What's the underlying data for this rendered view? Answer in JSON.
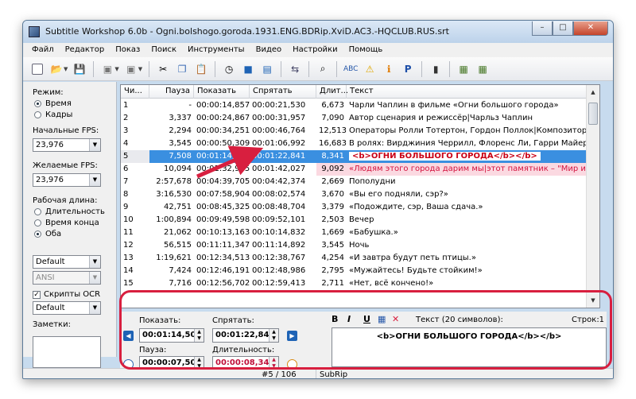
{
  "window": {
    "title": "Subtitle Workshop 6.0b - Ogni.bolshogo.goroda.1931.ENG.BDRip.XviD.AC3.-HQCLUB.RUS.srt",
    "buttons": {
      "minimize": "–",
      "maximize": "□",
      "close": "✕"
    }
  },
  "menu": [
    "Файл",
    "Редактор",
    "Показ",
    "Поиск",
    "Инструменты",
    "Видео",
    "Настройки",
    "Помощь"
  ],
  "left": {
    "mode_label": "Режим:",
    "mode_time": "Время",
    "mode_frames": "Кадры",
    "start_fps_label": "Начальные FPS:",
    "start_fps": "23,976",
    "desired_fps_label": "Желаемые FPS:",
    "desired_fps": "23,976",
    "work_length_label": "Рабочая длина:",
    "wl_duration": "Длительность",
    "wl_end_time": "Время конца",
    "wl_both": "Оба",
    "style_combo": "Default",
    "encoding_combo": "ANSI",
    "ocr_scripts": "Скрипты OCR",
    "ocr_combo": "Default",
    "notes_label": "Заметки:"
  },
  "grid": {
    "headers": {
      "num": "Чи...",
      "pause": "Пауза",
      "show": "Показать",
      "hide": "Спрятать",
      "dur": "Длит...",
      "text": "Текст"
    },
    "rows": [
      {
        "num": "1",
        "pause": "-",
        "show": "00:00:14,857",
        "hide": "00:00:21,530",
        "dur": "6,673",
        "text": "Чарли Чаплин в фильме «Огни большого города»"
      },
      {
        "num": "2",
        "pause": "3,337",
        "show": "00:00:24,867",
        "hide": "00:00:31,957",
        "dur": "7,090",
        "text": "Автор сценария и режиссёр|Чарльз Чаплин"
      },
      {
        "num": "3",
        "pause": "2,294",
        "show": "00:00:34,251",
        "hide": "00:00:46,764",
        "dur": "12,513",
        "text": "Операторы Ролли Тотертон, Гордон Поллок|Композитор Чарл..."
      },
      {
        "num": "4",
        "pause": "3,545",
        "show": "00:00:50,309",
        "hide": "00:01:06,992",
        "dur": "16,683",
        "text": "В ролях: Вирджиния Черрилл, Флоренс Ли, Гарри Майерс,|Алл..."
      },
      {
        "num": "5",
        "pause": "7,508",
        "show": "00:01:14,500",
        "hide": "00:01:22,841",
        "dur": "8,341",
        "text": "<b>ОГНИ БОЛЬШОГО ГОРОДА</b></b>"
      },
      {
        "num": "6",
        "pause": "10,094",
        "show": "00:01:32,935",
        "hide": "00:01:42,027",
        "dur": "9,092",
        "text": "«Людям этого города дарим мы|этот памятник – \"Мир и процв..."
      },
      {
        "num": "7",
        "pause": "2:57,678",
        "show": "00:04:39,705",
        "hide": "00:04:42,374",
        "dur": "2,669",
        "text": "Пополудни"
      },
      {
        "num": "8",
        "pause": "3:16,530",
        "show": "00:07:58,904",
        "hide": "00:08:02,574",
        "dur": "3,670",
        "text": "«Вы его подняли, сэр?»"
      },
      {
        "num": "9",
        "pause": "42,751",
        "show": "00:08:45,325",
        "hide": "00:08:48,704",
        "dur": "3,379",
        "text": "«Подождите, сэр, Ваша сдача.»"
      },
      {
        "num": "10",
        "pause": "1:00,894",
        "show": "00:09:49,598",
        "hide": "00:09:52,101",
        "dur": "2,503",
        "text": "Вечер"
      },
      {
        "num": "11",
        "pause": "21,062",
        "show": "00:10:13,163",
        "hide": "00:10:14,832",
        "dur": "1,669",
        "text": "«Бабушка.»"
      },
      {
        "num": "12",
        "pause": "56,515",
        "show": "00:11:11,347",
        "hide": "00:11:14,892",
        "dur": "3,545",
        "text": "Ночь"
      },
      {
        "num": "13",
        "pause": "1:19,621",
        "show": "00:12:34,513",
        "hide": "00:12:38,767",
        "dur": "4,254",
        "text": "«И завтра будут петь птицы.»"
      },
      {
        "num": "14",
        "pause": "7,424",
        "show": "00:12:46,191",
        "hide": "00:12:48,986",
        "dur": "2,795",
        "text": "«Мужайтесь! Будьте стойким!»"
      },
      {
        "num": "15",
        "pause": "7,716",
        "show": "00:12:56,702",
        "hide": "00:12:59,413",
        "dur": "2,711",
        "text": "«Нет, всё кончено!»"
      }
    ]
  },
  "editor": {
    "show_label": "Показать:",
    "show_value": "00:01:14,500",
    "hide_label": "Спрятать:",
    "hide_value": "00:01:22,841",
    "pause_label": "Пауза:",
    "pause_value": "00:00:07,508",
    "dur_label": "Длительность:",
    "dur_value": "00:00:08,341",
    "bold": "B",
    "italic": "I",
    "underline": "U",
    "delete": "✕",
    "text_info": "Текст (20 символов):",
    "lines_info": "Строк:1",
    "text_value": "<b>ОГНИ БОЛЬШОГО ГОРОДА</b></b>"
  },
  "status": {
    "position": "#5 / 106",
    "format": "SubRip"
  }
}
